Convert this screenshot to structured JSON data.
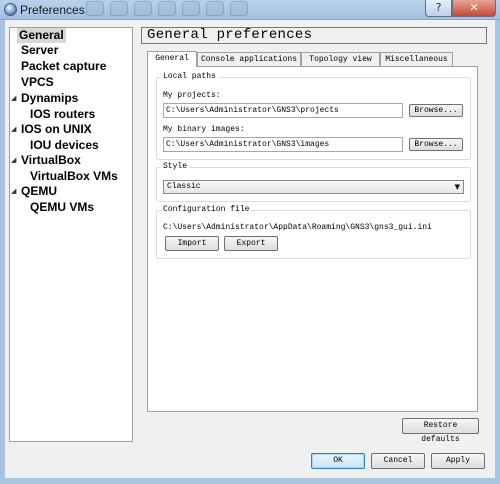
{
  "window": {
    "title": "Preferences",
    "help_label": "?",
    "close_label": "✕"
  },
  "sidebar": {
    "items": [
      {
        "label": "General",
        "selected": true
      },
      {
        "label": "Server"
      },
      {
        "label": "Packet capture"
      },
      {
        "label": "VPCS"
      },
      {
        "label": "Dynamips",
        "expandable": true
      },
      {
        "label": "IOS routers",
        "child": true
      },
      {
        "label": "IOS on UNIX",
        "expandable": true
      },
      {
        "label": "IOU devices",
        "child": true
      },
      {
        "label": "VirtualBox",
        "expandable": true
      },
      {
        "label": "VirtualBox VMs",
        "child": true
      },
      {
        "label": "QEMU",
        "expandable": true
      },
      {
        "label": "QEMU VMs",
        "child": true
      }
    ]
  },
  "page": {
    "title": "General preferences"
  },
  "tabs": [
    {
      "label": "General",
      "active": true
    },
    {
      "label": "Console applications"
    },
    {
      "label": "Topology view"
    },
    {
      "label": "Miscellaneous"
    }
  ],
  "local_paths": {
    "group_title": "Local paths",
    "projects_label": "My projects:",
    "projects_value": "C:\\Users\\Administrator\\GNS3\\projects",
    "images_label": "My binary images:",
    "images_value": "C:\\Users\\Administrator\\GNS3\\images",
    "browse_label": "Browse..."
  },
  "style": {
    "group_title": "Style",
    "selected": "Classic",
    "caret": "▼"
  },
  "config": {
    "group_title": "Configuration file",
    "path": "C:\\Users\\Administrator\\AppData\\Roaming\\GNS3\\gns3_gui.ini",
    "import_label": "Import",
    "export_label": "Export"
  },
  "footer": {
    "restore_label": "Restore defaults",
    "ok_label": "OK",
    "cancel_label": "Cancel",
    "apply_label": "Apply"
  },
  "colors": {
    "titlebar": "#b9d1ea",
    "close": "#c74a32",
    "selection": "#d7d7d7"
  },
  "icons": [
    "preferences-app-icon",
    "expand-arrow-icon",
    "dropdown-caret-icon"
  ]
}
